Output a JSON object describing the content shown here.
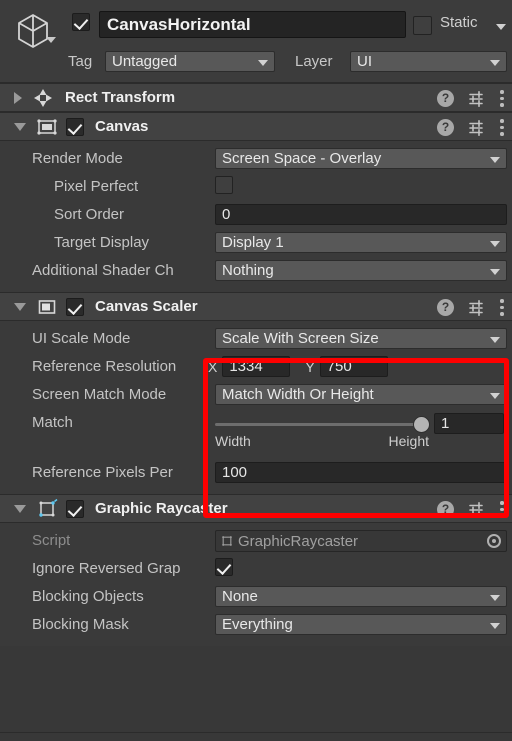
{
  "object_header": {
    "icon": "cube-icon",
    "active_checkbox": true,
    "name": "CanvasHorizontal",
    "static_label": "Static",
    "static_checked": false,
    "tag_label": "Tag",
    "tag_value": "Untagged",
    "layer_label": "Layer",
    "layer_value": "UI"
  },
  "components": [
    {
      "title": "Rect Transform",
      "icon": "rect-transform-icon",
      "expanded": false,
      "has_enable_checkbox": false
    },
    {
      "title": "Canvas",
      "icon": "canvas-icon",
      "expanded": true,
      "has_enable_checkbox": true,
      "enabled": true,
      "properties": [
        {
          "label": "Render Mode",
          "type": "dropdown",
          "value": "Screen Space - Overlay",
          "indent": 0
        },
        {
          "label": "Pixel Perfect",
          "type": "checkbox",
          "value": false,
          "indent": 1
        },
        {
          "label": "Sort Order",
          "type": "text",
          "value": "0",
          "indent": 1
        },
        {
          "label": "Target Display",
          "type": "dropdown",
          "value": "Display 1",
          "indent": 1
        },
        {
          "label": "Additional Shader Ch",
          "type": "dropdown",
          "value": "Nothing",
          "indent": 0
        }
      ]
    },
    {
      "title": "Canvas Scaler",
      "icon": "canvas-scaler-icon",
      "expanded": true,
      "has_enable_checkbox": true,
      "enabled": true,
      "properties": [
        {
          "label": "UI Scale Mode",
          "type": "dropdown",
          "value": "Scale With Screen Size",
          "indent": 0
        },
        {
          "label": "Reference Resolution",
          "type": "vector2",
          "x_label": "X",
          "x_value": "1334",
          "y_label": "Y",
          "y_value": "750",
          "indent": 0
        },
        {
          "label": "Screen Match Mode",
          "type": "dropdown",
          "value": "Match Width Or Height",
          "indent": 0
        },
        {
          "label": "Match",
          "type": "slider",
          "value": "1",
          "min_label": "Width",
          "max_label": "Height",
          "fill": 100,
          "indent": 0
        },
        {
          "label": "Reference Pixels Per",
          "type": "text",
          "value": "100",
          "indent": 0
        }
      ]
    },
    {
      "title": "Graphic Raycaster",
      "icon": "graphic-raycaster-icon",
      "expanded": true,
      "has_enable_checkbox": true,
      "enabled": true,
      "properties": [
        {
          "label": "Script",
          "type": "object",
          "value": "GraphicRaycaster",
          "indent": 0
        },
        {
          "label": "Ignore Reversed Grap",
          "type": "checkbox",
          "value": true,
          "indent": 0
        },
        {
          "label": "Blocking Objects",
          "type": "dropdown",
          "value": "None",
          "indent": 0
        },
        {
          "label": "Blocking Mask",
          "type": "dropdown",
          "value": "Everything",
          "indent": 0
        }
      ]
    }
  ],
  "header_icons": {
    "help": "?",
    "settings": "settings-icon",
    "menu": "kebab-menu-icon"
  },
  "annotation": {
    "type": "highlight-rectangle",
    "color": "#fe0000"
  },
  "colors": {
    "panel_bg": "#383838",
    "header_bg": "#424242",
    "dropdown_bg": "#585858",
    "textfield_bg": "#282828",
    "text": "#c8c8c8",
    "highlight": "#fe0000"
  }
}
